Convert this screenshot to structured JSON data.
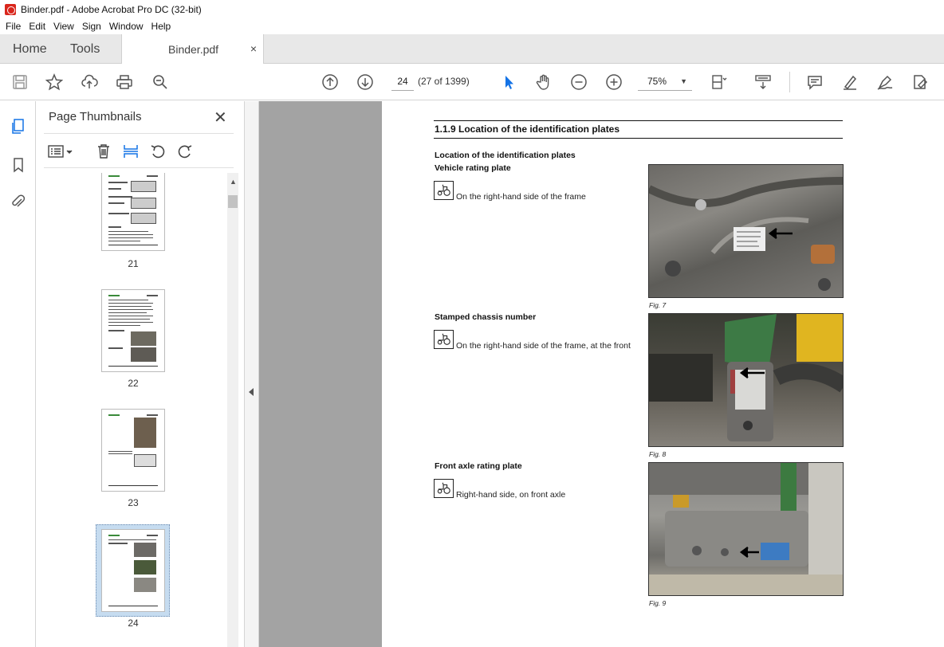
{
  "window": {
    "title": "Binder.pdf - Adobe Acrobat Pro DC (32-bit)"
  },
  "menu": {
    "items": [
      "File",
      "Edit",
      "View",
      "Sign",
      "Window",
      "Help"
    ]
  },
  "tabs": {
    "home": "Home",
    "tools": "Tools",
    "document": "Binder.pdf",
    "close": "×"
  },
  "toolbar": {
    "page_number": "24",
    "page_count": "(27 of 1399)",
    "zoom": "75%",
    "icons": [
      "save-icon",
      "star-icon",
      "upload-icon",
      "print-icon",
      "search-icon",
      "previous-page-icon",
      "next-page-icon",
      "select-icon",
      "hand-icon",
      "zoom-out-icon",
      "zoom-in-icon",
      "page-fit-icon",
      "scroll-mode-icon",
      "comment-icon",
      "highlight-icon",
      "sign-icon",
      "edit-pdf-icon"
    ]
  },
  "thumbnails": {
    "title": "Page Thumbnails",
    "close": "✕",
    "items": [
      {
        "label": "21"
      },
      {
        "label": "22"
      },
      {
        "label": "23"
      },
      {
        "label": "24",
        "selected": true
      }
    ]
  },
  "document": {
    "section_title": "1.1.9  Location of the identification plates",
    "subheading": "Location of the identification plates",
    "entries": [
      {
        "heading": "Vehicle rating plate",
        "text": "On the right-hand side of the frame",
        "figure": "Fig. 7"
      },
      {
        "heading": "Stamped chassis number",
        "text": "On the right-hand side of the frame, at the front",
        "figure": "Fig. 8"
      },
      {
        "heading": "Front axle rating plate",
        "text": "Right-hand side, on front axle",
        "figure": "Fig. 9"
      }
    ]
  }
}
